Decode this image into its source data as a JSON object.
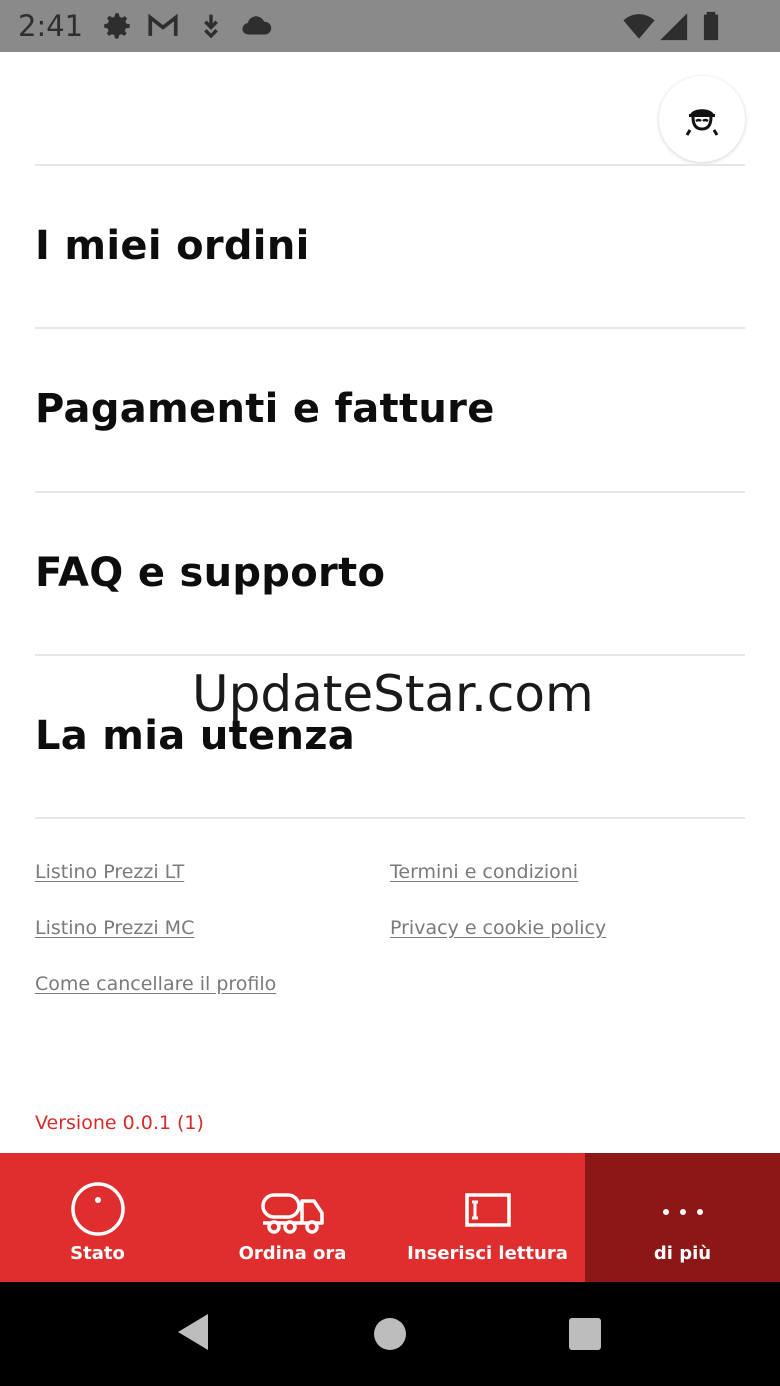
{
  "status_bar": {
    "time": "2:41",
    "icons": [
      "gear-icon",
      "gmail-icon",
      "download-icon",
      "cloud-icon",
      "wifi-icon",
      "signal-icon",
      "battery-icon"
    ]
  },
  "header": {
    "profile_icon": "user-avatar-icon"
  },
  "menu": {
    "items": [
      {
        "label": "I miei ordini"
      },
      {
        "label": "Pagamenti e fatture"
      },
      {
        "label": "FAQ e supporto"
      },
      {
        "label": "La mia utenza"
      }
    ]
  },
  "links": {
    "listino_lt": "Listino Prezzi LT",
    "listino_mc": "Listino Prezzi MC",
    "cancel_profile": "Come cancellare il profilo",
    "terms": "Termini e condizioni",
    "privacy": "Privacy e cookie policy"
  },
  "watermark": "UpdateStar.com",
  "version": "Versione 0.0.1 (1)",
  "tab_bar": {
    "tabs": [
      {
        "label": "Stato",
        "icon": "gauge-icon"
      },
      {
        "label": "Ordina ora",
        "icon": "truck-icon"
      },
      {
        "label": "Inserisci lettura",
        "icon": "meter-reading-icon"
      },
      {
        "label": "di più",
        "icon": "more-dots-icon"
      }
    ],
    "active_index": 3
  },
  "colors": {
    "brand_red": "#e02e2e",
    "active_tab": "#8d1717",
    "version_text": "#d42b2b",
    "status_bar": "#8a8a8a"
  }
}
